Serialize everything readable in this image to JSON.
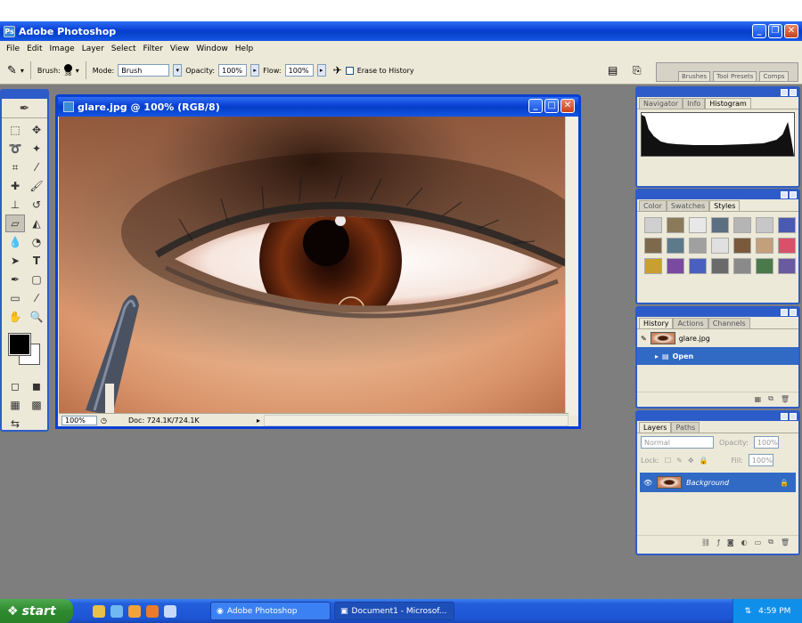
{
  "app": {
    "title": "Adobe Photoshop"
  },
  "menu": [
    "File",
    "Edit",
    "Image",
    "Layer",
    "Select",
    "Filter",
    "View",
    "Window",
    "Help"
  ],
  "options": {
    "brush_label": "Brush:",
    "brush_size": "38",
    "mode_label": "Mode:",
    "mode_value": "Brush",
    "opacity_label": "Opacity:",
    "opacity_value": "100%",
    "flow_label": "Flow:",
    "flow_value": "100%",
    "erase_history": "Erase to History",
    "well_tabs": [
      "Brushes",
      "Tool Presets",
      "Comps"
    ]
  },
  "document": {
    "title": "glare.jpg @ 100% (RGB/8)",
    "zoom": "100%",
    "doc_info": "Doc: 724.1K/724.1K"
  },
  "navigator_panel": {
    "tabs": [
      "Navigator",
      "Info",
      "Histogram"
    ],
    "active": "Histogram"
  },
  "styles_panel": {
    "tabs": [
      "Color",
      "Swatches",
      "Styles"
    ],
    "active": "Styles",
    "swatch_colors": [
      "#cfcfcf",
      "#8a7a5a",
      "#e8e8e8",
      "#5c6f82",
      "#b5b5b5",
      "#c7c7c7",
      "#4a5ab0",
      "#7d6a4c",
      "#5d7a8a",
      "#a0a0a0",
      "#e0e0e0",
      "#7a5a3a",
      "#c39f7b",
      "#d8506a",
      "#c8a030",
      "#7a4aa0",
      "#4a60c0",
      "#6a6a6a",
      "#8a8a8a",
      "#4a7a4a",
      "#6a5aa0"
    ]
  },
  "history_panel": {
    "tabs": [
      "History",
      "Actions",
      "Channels"
    ],
    "active": "History",
    "snapshot": "glare.jpg",
    "items": [
      "Open"
    ]
  },
  "layers_panel": {
    "tabs": [
      "Layers",
      "Paths"
    ],
    "active": "Layers",
    "blend": "Normal",
    "opacity_label": "Opacity:",
    "opacity_value": "100%",
    "lock_label": "Lock:",
    "fill_label": "Fill:",
    "fill_value": "100%",
    "layers": [
      "Background"
    ]
  },
  "taskbar": {
    "start": "start",
    "buttons": [
      "Adobe Photoshop",
      "Document1 - Microsof..."
    ],
    "clock": "4:59 PM"
  },
  "colors": {
    "title_blue": "#0a3fd4",
    "chrome": "#ece9d8",
    "workspace": "#7e7e7e",
    "selected": "#316ac5"
  }
}
